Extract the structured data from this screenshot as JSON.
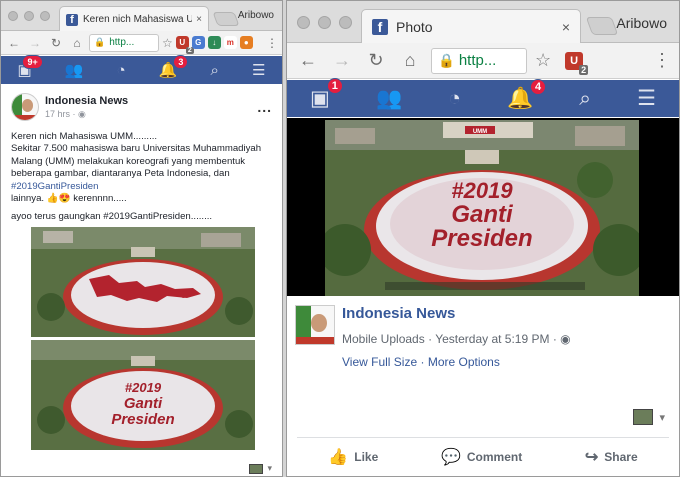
{
  "left_window": {
    "tab_title": "Keren nich Mahasiswa UMM.",
    "tab_close": "×",
    "user_name": "Aribowo",
    "url": "http...",
    "ext_badge": "2",
    "fb_icons": [
      "home-icon",
      "friends-icon",
      "messenger-icon",
      "notifications-icon",
      "search-icon",
      "menu-icon"
    ],
    "home_badge": "9+",
    "notif_badge": "3",
    "post": {
      "page_name": "Indonesia News",
      "time": "17 hrs",
      "more": "...",
      "lines": [
        "Keren nich Mahasiswa UMM.........",
        "Sekitar 7.500 mahasiswa baru Universitas Muhammadiyah Malang (UMM) melakukan koreografi yang membentuk beberapa gambar, diantaranya Peta Indonesia, dan"
      ],
      "hashtag1": "#2019GantiPresiden",
      "line3": "lainnya. 👍😍 kerennnn.....",
      "line4": "ayoo terus gaungkan #2019GantiPresiden........",
      "photo2_text1": "#2019",
      "photo2_text2": "Ganti",
      "photo2_text3": "Presiden"
    }
  },
  "right_window": {
    "tab_title": "Photo",
    "tab_close": "×",
    "user_name": "Aribowo",
    "url": "http...",
    "ext_badge": "2",
    "home_badge": "1",
    "notif_badge": "4",
    "photo_text1": "#2019",
    "photo_text2": "Ganti",
    "photo_text3": "Presiden",
    "photo_sign": "UMM",
    "info": {
      "page_name": "Indonesia News",
      "album": "Mobile Uploads",
      "sep": "·",
      "time": "Yesterday at 5:19 PM",
      "view_full": "View Full Size",
      "more_options": "More Options"
    },
    "actions": {
      "like": "Like",
      "comment": "Comment",
      "share": "Share"
    }
  },
  "colors": {
    "fb_blue": "#3b5998",
    "link_blue": "#365899",
    "badge_red": "#e41e3f",
    "secure_green": "#0b8043"
  }
}
